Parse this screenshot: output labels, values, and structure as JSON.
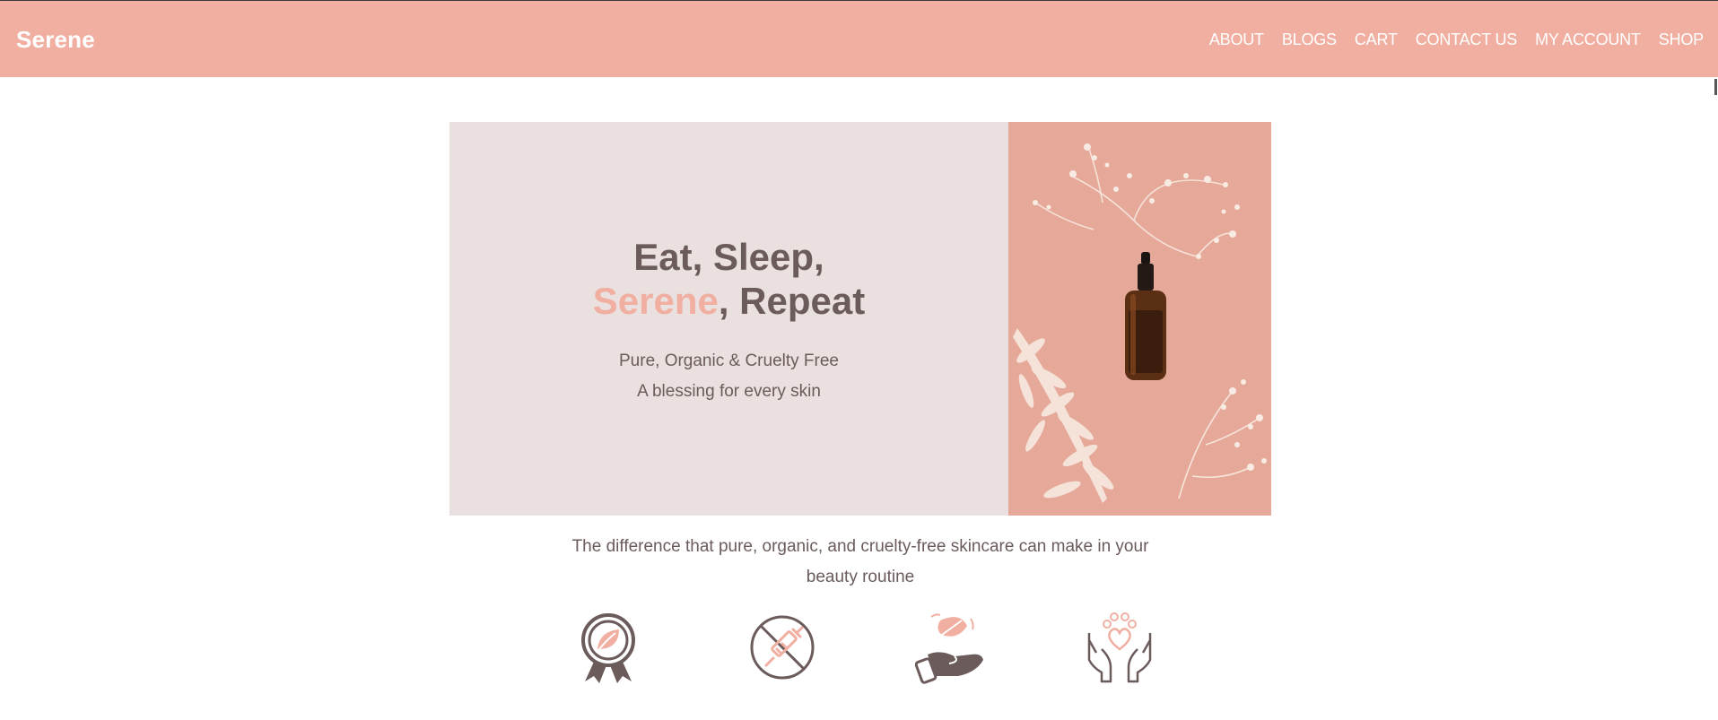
{
  "nav": {
    "brand": "Serene",
    "links": [
      "ABOUT",
      "BLOGS",
      "CART",
      "CONTACT US",
      "MY ACCOUNT",
      "SHOP"
    ]
  },
  "hero": {
    "title_line1": "Eat, Sleep,",
    "title_accent": "Serene",
    "title_line2_rest": ", Repeat",
    "subtitle_line1": "Pure, Organic & Cruelty Free",
    "subtitle_line2": "A blessing for every skin"
  },
  "tagline": "The difference that pure, organic, and cruelty-free skincare can make in your beauty routine",
  "features": [
    {
      "icon": "organic-badge-icon"
    },
    {
      "icon": "no-injection-icon"
    },
    {
      "icon": "natural-hand-leaf-icon"
    },
    {
      "icon": "cruelty-free-paw-heart-icon"
    }
  ],
  "colors": {
    "brand_pink": "#f0afa1",
    "text_mauve": "#6b5b5b",
    "hero_bg": "#eae0e0",
    "image_bg": "#e6a898"
  }
}
